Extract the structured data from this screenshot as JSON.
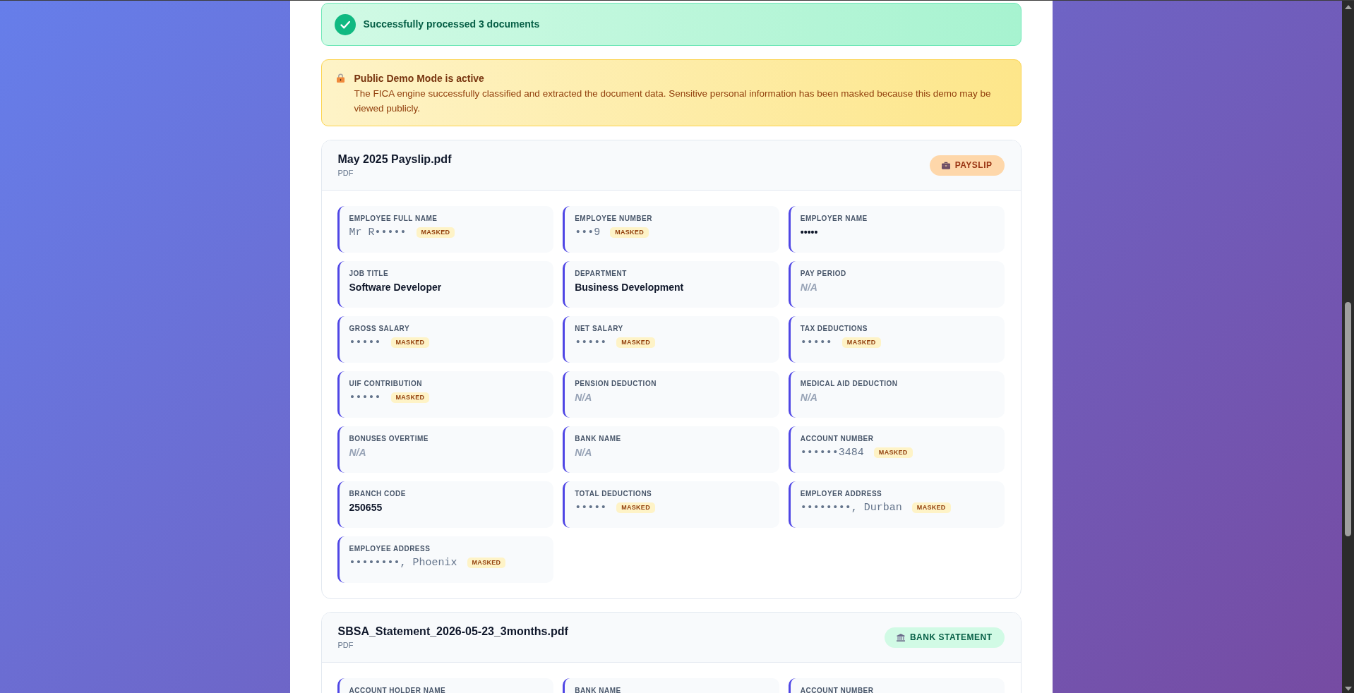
{
  "success_banner": {
    "message": "Successfully processed 3 documents"
  },
  "notice": {
    "title": "Public Demo Mode is active",
    "body": "The FICA engine successfully classified and extracted the document data. Sensitive personal information has been masked because this demo may be viewed publicly."
  },
  "documents": [
    {
      "file_name": "May 2025 Payslip.pdf",
      "file_type": "PDF",
      "type_badge": {
        "kind": "payslip",
        "label": "PAYSLIP"
      },
      "fields": [
        {
          "label": "EMPLOYEE FULL NAME",
          "kind": "masked",
          "value": "Mr R•••••",
          "tag": "MASKED"
        },
        {
          "label": "EMPLOYEE NUMBER",
          "kind": "masked",
          "value": "•••9",
          "tag": "MASKED"
        },
        {
          "label": "EMPLOYER NAME",
          "kind": "text",
          "value": "•••••"
        },
        {
          "label": "JOB TITLE",
          "kind": "text",
          "value": "Software Developer"
        },
        {
          "label": "DEPARTMENT",
          "kind": "text",
          "value": "Business Development"
        },
        {
          "label": "PAY PERIOD",
          "kind": "empty",
          "value": "N/A"
        },
        {
          "label": "GROSS SALARY",
          "kind": "masked",
          "value": "•••••",
          "tag": "MASKED"
        },
        {
          "label": "NET SALARY",
          "kind": "masked",
          "value": "•••••",
          "tag": "MASKED"
        },
        {
          "label": "TAX DEDUCTIONS",
          "kind": "masked",
          "value": "•••••",
          "tag": "MASKED"
        },
        {
          "label": "UIF CONTRIBUTION",
          "kind": "masked",
          "value": "•••••",
          "tag": "MASKED"
        },
        {
          "label": "PENSION DEDUCTION",
          "kind": "empty",
          "value": "N/A"
        },
        {
          "label": "MEDICAL AID DEDUCTION",
          "kind": "empty",
          "value": "N/A"
        },
        {
          "label": "BONUSES OVERTIME",
          "kind": "empty",
          "value": "N/A"
        },
        {
          "label": "BANK NAME",
          "kind": "empty",
          "value": "N/A"
        },
        {
          "label": "ACCOUNT NUMBER",
          "kind": "masked",
          "value": "••••••3484",
          "tag": "MASKED"
        },
        {
          "label": "BRANCH CODE",
          "kind": "text",
          "value": "250655"
        },
        {
          "label": "TOTAL DEDUCTIONS",
          "kind": "masked",
          "value": "•••••",
          "tag": "MASKED"
        },
        {
          "label": "EMPLOYER ADDRESS",
          "kind": "masked",
          "value": "••••••••, Durban",
          "tag": "MASKED"
        },
        {
          "label": "EMPLOYEE ADDRESS",
          "kind": "masked",
          "value": "••••••••, Phoenix",
          "tag": "MASKED"
        }
      ]
    },
    {
      "file_name": "SBSA_Statement_2026-05-23_3months.pdf",
      "file_type": "PDF",
      "type_badge": {
        "kind": "bank_statement",
        "label": "BANK STATEMENT"
      },
      "fields": [
        {
          "label": "ACCOUNT HOLDER NAME"
        },
        {
          "label": "BANK NAME"
        },
        {
          "label": "ACCOUNT NUMBER"
        }
      ]
    }
  ]
}
